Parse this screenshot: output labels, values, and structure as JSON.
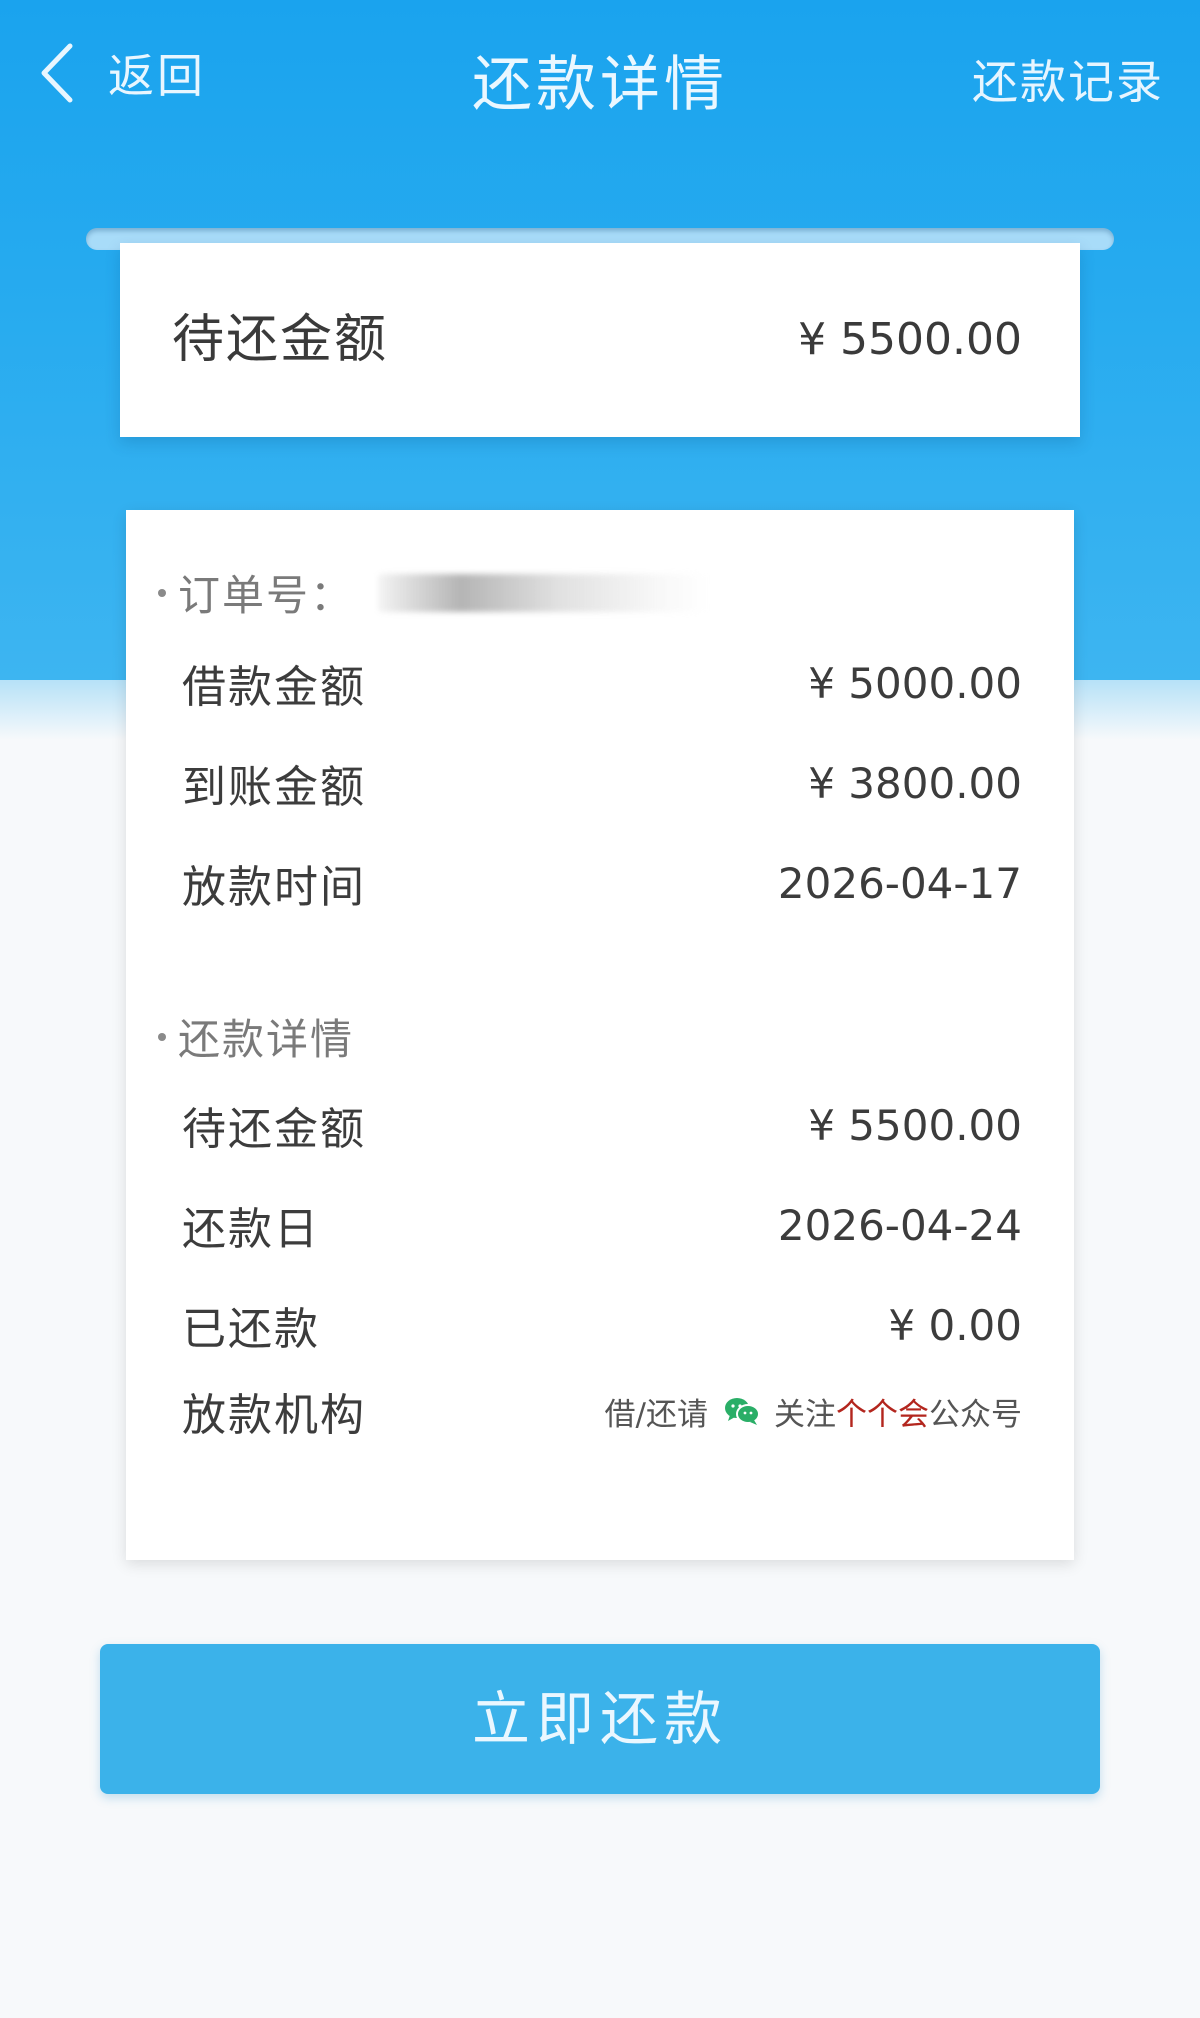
{
  "nav": {
    "back_label": "返回",
    "title": "还款详情",
    "records_label": "还款记录"
  },
  "summary": {
    "label": "待还金额",
    "amount": "¥ 5500.00"
  },
  "loan_section": {
    "order_label": "订单号：",
    "rows": [
      {
        "label": "借款金额",
        "value": "¥ 5000.00"
      },
      {
        "label": "到账金额",
        "value": "¥ 3800.00"
      },
      {
        "label": "放款时间",
        "value": "2026-04-17"
      }
    ]
  },
  "repay_section": {
    "title": "还款详情",
    "rows": [
      {
        "label": "待还金额",
        "value": "¥ 5500.00"
      },
      {
        "label": "还款日",
        "value": "2026-04-24"
      },
      {
        "label": "已还款",
        "value": "¥ 0.00"
      }
    ],
    "institution": {
      "label": "放款机构",
      "prefix": "借/还请",
      "follow": "关注",
      "brand": "个个会",
      "suffix": "公众号"
    }
  },
  "action": {
    "repay_label": "立即还款"
  },
  "colors": {
    "header_blue": "#1aa3ee",
    "button_blue": "#3bb2ea",
    "brand_red": "#b3261e",
    "wechat_green": "#2aae67"
  },
  "icons": {
    "back": "chevron-left-icon",
    "wechat": "wechat-icon"
  }
}
